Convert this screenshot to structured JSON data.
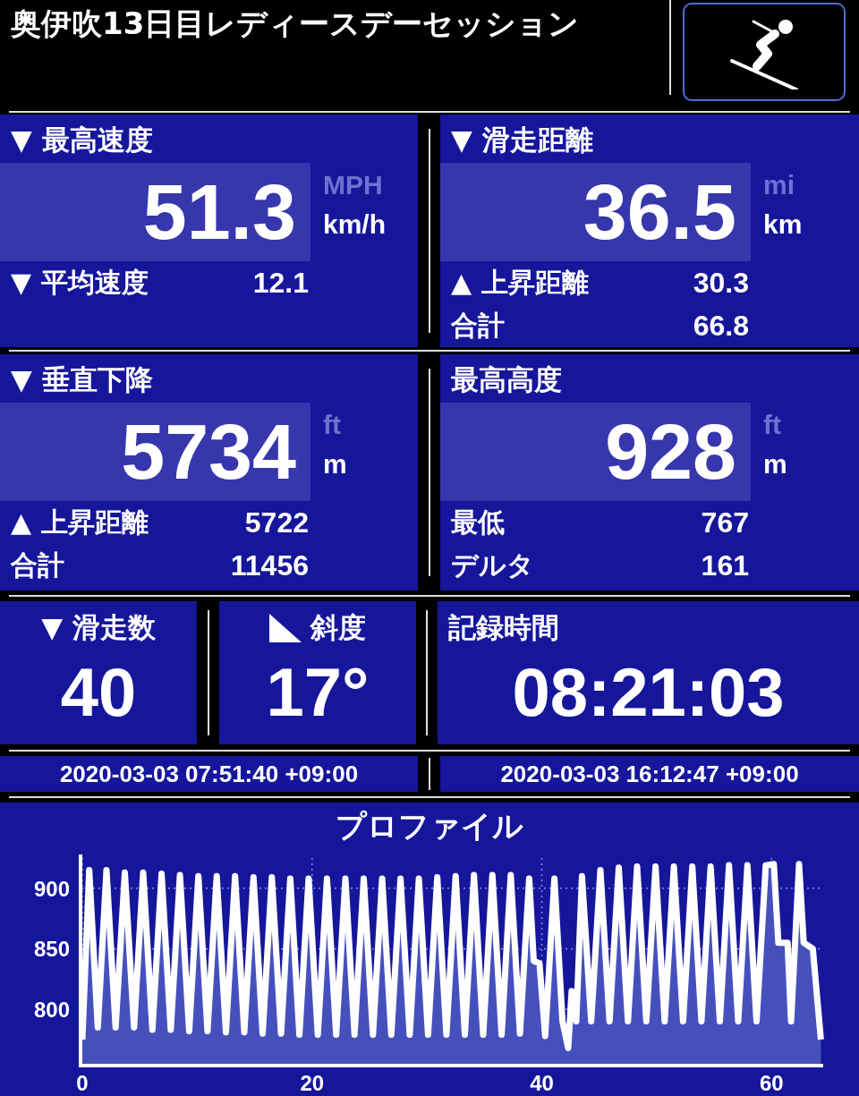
{
  "header": {
    "title": "奥伊吹13日目レディースデーセッション"
  },
  "panels": [
    {
      "label": "▼ 最高速度",
      "value": "51.3",
      "unit_alt": "MPH",
      "unit": "km/h",
      "rows": [
        {
          "label": "▼ 平均速度",
          "value": "12.1"
        }
      ]
    },
    {
      "label": "▼ 滑走距離",
      "value": "36.5",
      "unit_alt": "mi",
      "unit": "km",
      "rows": [
        {
          "label": "▲ 上昇距離",
          "value": "30.3"
        },
        {
          "label": "合計",
          "value": "66.8"
        }
      ]
    },
    {
      "label": "▼ 垂直下降",
      "value": "5734",
      "unit_alt": "ft",
      "unit": "m",
      "rows": [
        {
          "label": "▲ 上昇距離",
          "value": "5722"
        },
        {
          "label": "合計",
          "value": "11456"
        }
      ]
    },
    {
      "label": "最高高度",
      "value": "928",
      "unit_alt": "ft",
      "unit": "m",
      "rows": [
        {
          "label": "最低",
          "value": "767"
        },
        {
          "label": "デルタ",
          "value": "161"
        }
      ]
    }
  ],
  "counters": [
    {
      "kind": "count",
      "label": "▼ 滑走数",
      "value": "40"
    },
    {
      "kind": "slope",
      "label": "斜度",
      "value": "17°"
    },
    {
      "kind": "time",
      "label": "記録時間",
      "value": "08:21:03"
    }
  ],
  "times": [
    "2020-03-03 07:51:40 +09:00",
    "2020-03-03 16:12:47 +09:00"
  ],
  "profile": {
    "title": "プロファイル",
    "chart_data": {
      "type": "area",
      "grid": true,
      "xlim": [
        0,
        64.5
      ],
      "ylim": [
        755,
        925
      ],
      "xticks": [
        0,
        20,
        40,
        60
      ],
      "yticks": [
        800,
        850,
        900
      ],
      "x": [
        0,
        0.6,
        1.35,
        2.1,
        2.9,
        3.7,
        4.5,
        5.3,
        6.1,
        6.9,
        7.7,
        8.5,
        9.3,
        10.1,
        10.9,
        11.7,
        12.5,
        13.3,
        14.1,
        14.9,
        15.7,
        16.5,
        17.3,
        18.1,
        18.9,
        19.7,
        20.5,
        21.3,
        22.1,
        22.9,
        23.7,
        24.5,
        25.3,
        26.1,
        26.9,
        27.7,
        28.5,
        29.3,
        30.1,
        30.9,
        31.7,
        32.5,
        33.3,
        34.1,
        34.9,
        35.7,
        36.5,
        37.3,
        38.1,
        38.9,
        39.3,
        39.8,
        40.3,
        41.1,
        41.8,
        42.3,
        42.6,
        43.0,
        43.5,
        44.3,
        45.1,
        45.9,
        46.7,
        47.5,
        48.3,
        49.1,
        49.9,
        50.7,
        51.5,
        52.3,
        53.1,
        53.9,
        54.7,
        55.5,
        56.3,
        57.1,
        57.9,
        58.7,
        59.5,
        60.2,
        60.6,
        61.4,
        61.7,
        62.4,
        62.8,
        63.6,
        64.3
      ],
      "series": [
        {
          "color": "#ffffff",
          "values": [
            775,
            915,
            785,
            915,
            785,
            913,
            785,
            913,
            783,
            912,
            783,
            911,
            782,
            910,
            782,
            910,
            781,
            910,
            781,
            909,
            780,
            909,
            780,
            908,
            779,
            908,
            779,
            908,
            779,
            908,
            779,
            908,
            779,
            908,
            779,
            908,
            779,
            908,
            779,
            909,
            779,
            910,
            779,
            911,
            779,
            911,
            779,
            911,
            780,
            908,
            840,
            838,
            778,
            908,
            790,
            768,
            815,
            790,
            910,
            790,
            915,
            790,
            917,
            790,
            918,
            790,
            918,
            790,
            918,
            790,
            918,
            790,
            918,
            790,
            919,
            790,
            919,
            790,
            919,
            920,
            855,
            855,
            790,
            920,
            855,
            850,
            775
          ]
        }
      ]
    }
  }
}
